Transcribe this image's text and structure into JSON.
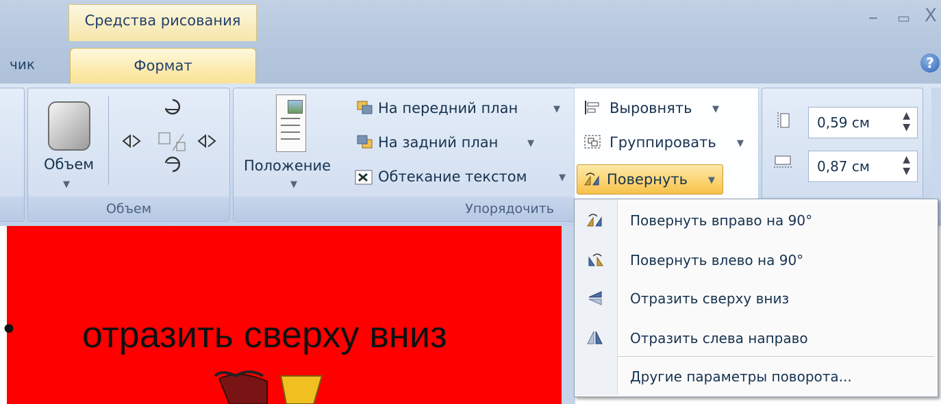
{
  "window": {
    "context_tab_group": "Средства рисования",
    "minimize_glyph": "–",
    "maximize_glyph": "▭",
    "close_glyph": "X",
    "help_glyph": "?"
  },
  "tabs": {
    "previous_tab_partial": "чик",
    "active_tab": "Формат"
  },
  "ribbon": {
    "volume_group": {
      "button_label": "Объем",
      "group_label": "Объем"
    },
    "arrange_group": {
      "position_label": "Положение",
      "bring_forward": "На передний план",
      "send_backward": "На задний план",
      "text_wrap": "Обтекание текстом",
      "group_label": "Упорядочить",
      "align": "Выровнять",
      "group": "Группировать",
      "rotate": "Повернуть"
    },
    "size": {
      "height_value": "0,59 см",
      "width_value": "0,87 см"
    }
  },
  "rotate_menu": {
    "items": [
      {
        "label": "Повернуть вправо на 90°",
        "icon": "rotate-right-icon"
      },
      {
        "label": "Повернуть влево на 90°",
        "icon": "rotate-left-icon"
      },
      {
        "label": "Отразить сверху вниз",
        "icon": "flip-vertical-icon"
      },
      {
        "label": "Отразить слева направо",
        "icon": "flip-horizontal-icon"
      }
    ],
    "more_options": "Другие параметры поворота..."
  },
  "slide": {
    "caption": "отразить сверху вниз",
    "background_color": "#ff0000"
  }
}
